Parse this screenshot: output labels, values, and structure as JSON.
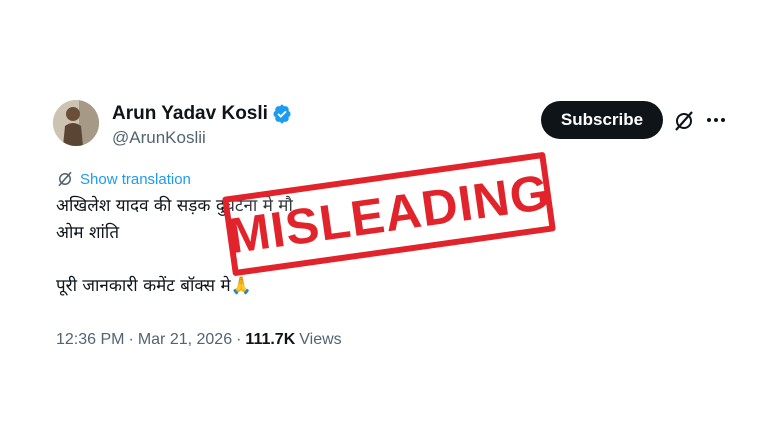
{
  "author": {
    "display_name": "Arun Yadav Kosli",
    "handle": "@ArunKoslii",
    "verified": true
  },
  "actions": {
    "subscribe_label": "Subscribe",
    "grok_icon": "grok-icon",
    "more_icon": "more-icon"
  },
  "translation": {
    "label": "Show translation",
    "icon": "translate-icon"
  },
  "tweet": {
    "lines": [
      "अखिलेश यादव की सड़क दुर्घटना मे मौ",
      " ओम शांति",
      "पूरी जानकारी कमेंट बॉक्स मे🙏"
    ]
  },
  "meta": {
    "time": "12:36 PM",
    "separator": "·",
    "date": "Mar 21, 2026",
    "views_count": "111.7K",
    "views_label": "Views"
  },
  "stamp": {
    "text": "MISLEADING",
    "color": "#e1232b"
  },
  "colors": {
    "text": "#0f1419",
    "secondary": "#536471",
    "link": "#1d9bf0",
    "verified": "#1d9bf0",
    "button_bg": "#0f1419"
  }
}
